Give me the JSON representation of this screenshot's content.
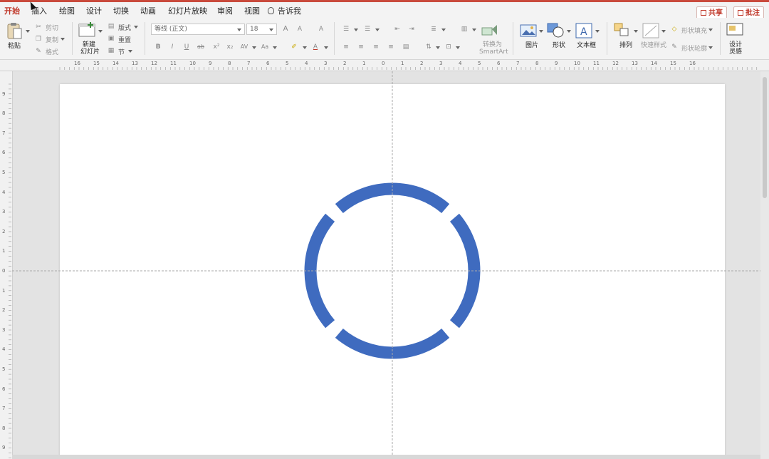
{
  "tabs": {
    "items": [
      "开始",
      "插入",
      "绘图",
      "设计",
      "切换",
      "动画",
      "幻灯片放映",
      "审阅",
      "视图"
    ],
    "tell_me": "告诉我",
    "share": "共享",
    "comments": "批注"
  },
  "clipboard": {
    "paste": "粘贴",
    "cut": "剪切",
    "copy": "复制",
    "format": "格式"
  },
  "slides": {
    "new_slide_line1": "新建",
    "new_slide_line2": "幻灯片",
    "layout": "版式",
    "reset": "重置",
    "section": "节"
  },
  "font": {
    "name": "等线 (正文)",
    "size": "18"
  },
  "paragraph": {
    "convert_line1": "转换为",
    "convert_line2": "SmartArt"
  },
  "insert": {
    "picture": "图片",
    "shape": "形状",
    "textbox": "文本框"
  },
  "drawing": {
    "arrange": "排列",
    "quick_styles": "快速样式",
    "shape_fill": "形状填充",
    "shape_outline": "形状轮廓"
  },
  "designer": {
    "line1": "设计",
    "line2": "灵感"
  },
  "ruler": {
    "h_labels": [
      "16",
      "15",
      "14",
      "13",
      "12",
      "11",
      "10",
      "9",
      "8",
      "7",
      "6",
      "5",
      "4",
      "3",
      "2",
      "1",
      "0",
      "1",
      "2",
      "3",
      "4",
      "5",
      "6",
      "7",
      "8",
      "9",
      "10",
      "11",
      "12",
      "13",
      "14",
      "15",
      "16"
    ],
    "v_labels": [
      "9",
      "8",
      "7",
      "6",
      "5",
      "4",
      "3",
      "2",
      "1",
      "0",
      "1",
      "2",
      "3",
      "4",
      "5",
      "6",
      "7",
      "8",
      "9"
    ]
  },
  "colors": {
    "accent": "#c0392b",
    "ring": "#3f6bbf",
    "guide": "#a8a8a8"
  },
  "shape": {
    "type": "segmented-ring",
    "segments": 4
  }
}
